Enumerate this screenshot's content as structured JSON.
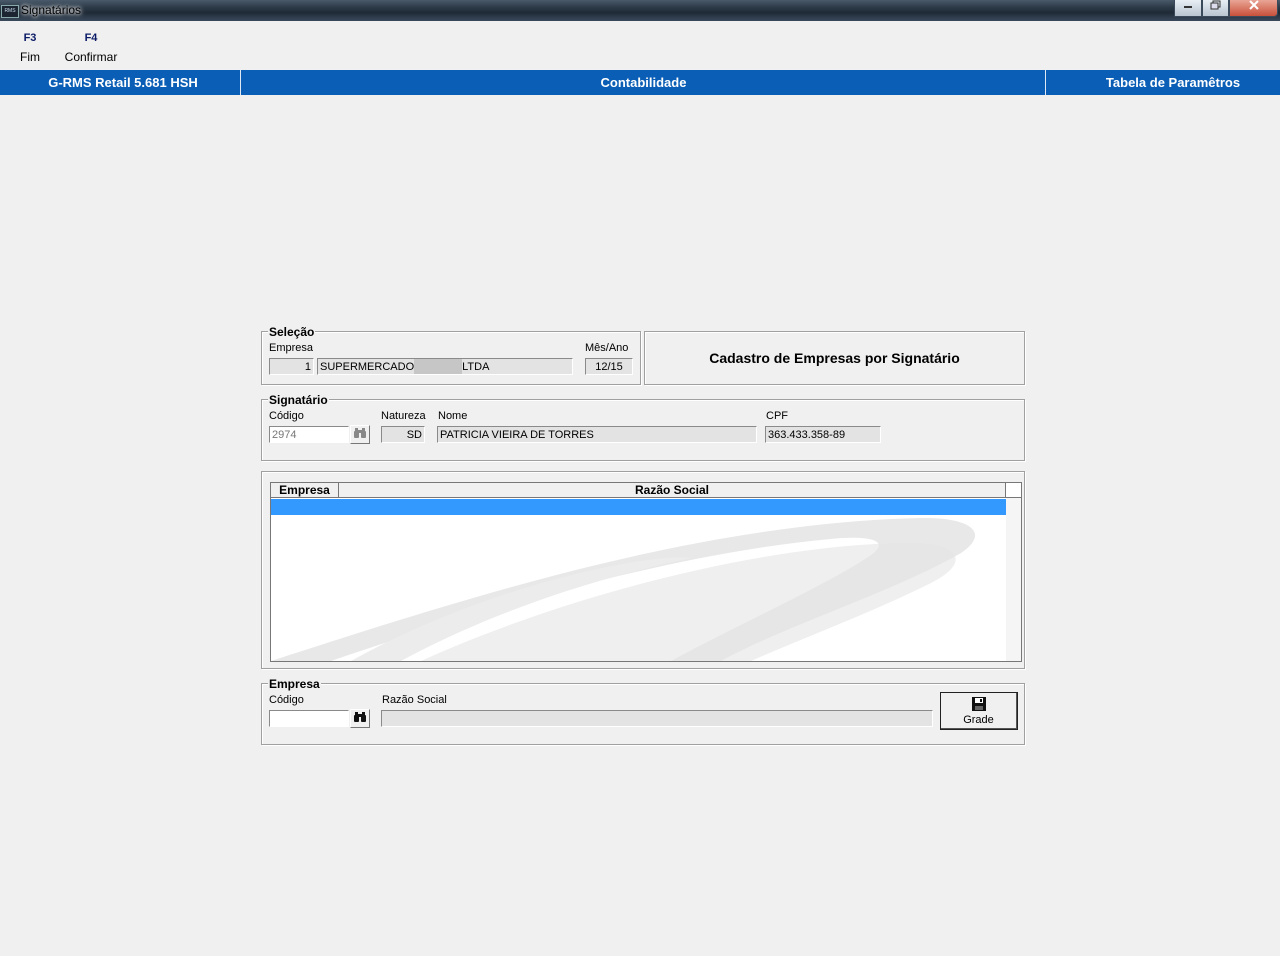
{
  "window": {
    "app_icon": "RMS",
    "title": "Signatários",
    "buttons": [
      "minimize-icon",
      "restore-icon",
      "close-icon"
    ]
  },
  "toolbar": {
    "f3": {
      "key": "F3",
      "label": "Fim"
    },
    "f4": {
      "key": "F4",
      "label": "Confirmar"
    }
  },
  "header": {
    "left": "G-RMS Retail 5.681 HSH",
    "center": "Contabilidade",
    "right": "Tabela de Paramêtros",
    "color": "#0a5eb5"
  },
  "selecao": {
    "title": "Seleção",
    "empresa_label": "Empresa",
    "empresa_code": "1",
    "empresa_name_part1": "SUPERMERCADO",
    "empresa_name_part2": "LTDA",
    "mes_ano_label": "Mês/Ano",
    "mes_ano": "12/15"
  },
  "cadastro_title": "Cadastro de Empresas por Signatário",
  "signatario": {
    "title": "Signatário",
    "codigo_label": "Código",
    "codigo": "2974",
    "natureza_label": "Natureza",
    "natureza": "SD",
    "nome_label": "Nome",
    "nome": "PATRICIA VIEIRA DE TORRES",
    "cpf_label": "CPF",
    "cpf": "363.433.358-89",
    "search_icon": "binoculars-icon"
  },
  "grid": {
    "columns": [
      "Empresa",
      "Razão Social"
    ],
    "rows": [],
    "selection_color": "#3399ff"
  },
  "empresa": {
    "title": "Empresa",
    "codigo_label": "Código",
    "codigo": "",
    "razao_label": "Razão Social",
    "razao": "",
    "search_icon": "binoculars-icon",
    "grade_label": "Grade",
    "grade_icon": "floppy-disk-icon"
  }
}
